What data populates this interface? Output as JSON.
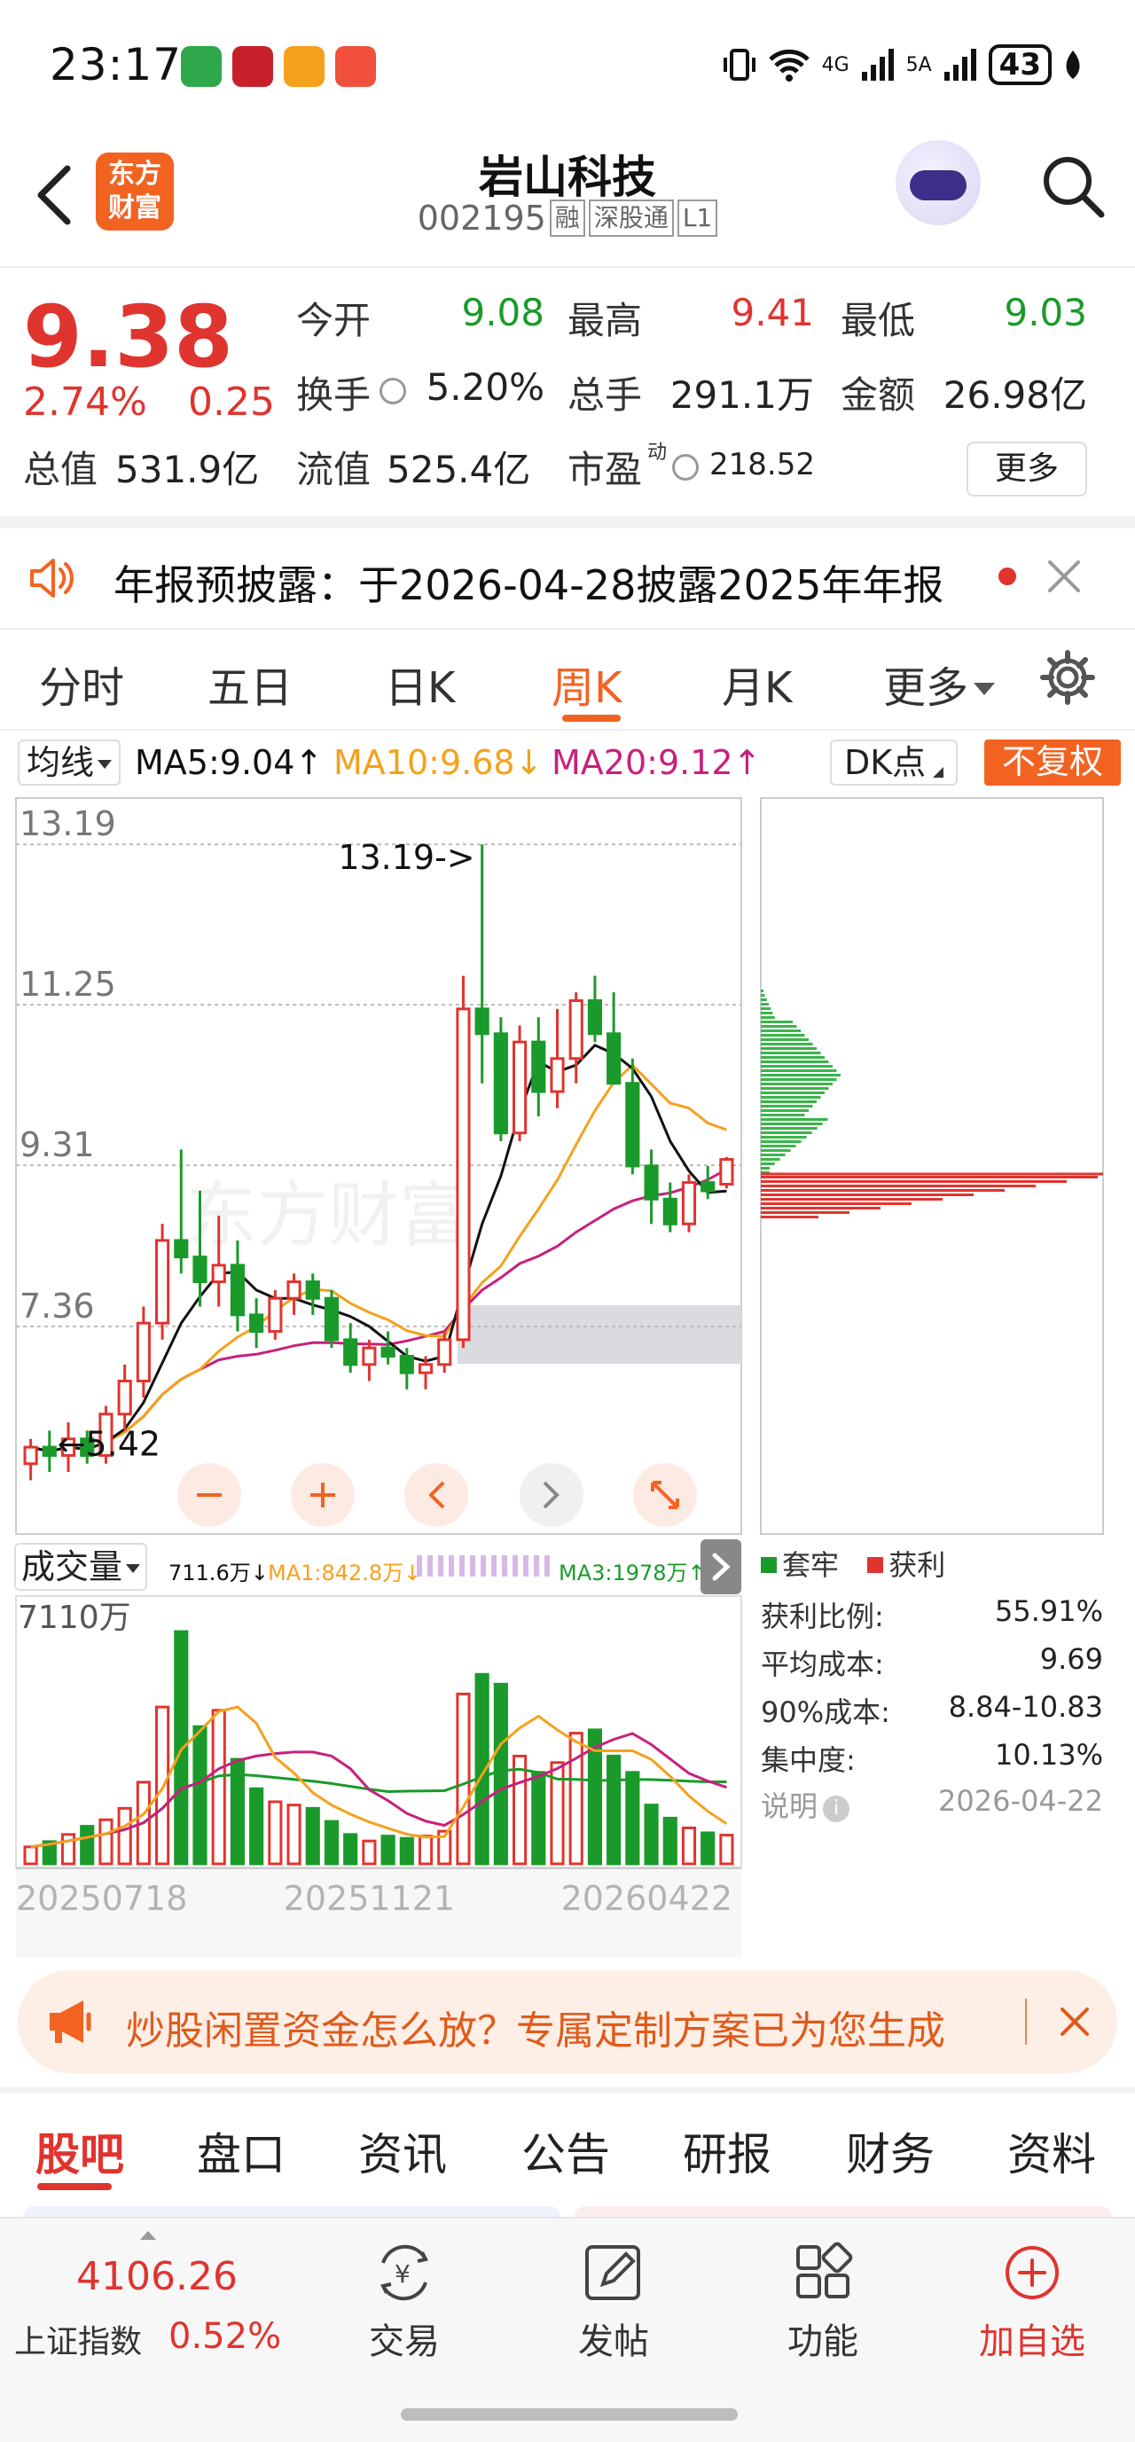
{
  "status": {
    "time": "23:17",
    "network": "4G",
    "network2": "5A",
    "battery": "43"
  },
  "header": {
    "title": "岩山科技",
    "code": "002195",
    "tags": [
      "融",
      "深股通",
      "L1"
    ],
    "logo_text": [
      "东方",
      "财富"
    ]
  },
  "quote": {
    "price": "9.38",
    "change_pct": "2.74%",
    "change": "0.25",
    "fields": [
      {
        "label": "今开",
        "value": "9.08",
        "color": "green"
      },
      {
        "label": "最高",
        "value": "9.41",
        "color": "red"
      },
      {
        "label": "最低",
        "value": "9.03",
        "color": "green"
      },
      {
        "label": "换手",
        "value": "5.20%",
        "color": "dark"
      },
      {
        "label": "总手",
        "value": "291.1万",
        "color": "dark"
      },
      {
        "label": "金额",
        "value": "26.98亿",
        "color": "dark"
      },
      {
        "label": "总值",
        "value": "531.9亿",
        "color": "dark"
      },
      {
        "label": "流值",
        "value": "525.4亿",
        "color": "dark"
      },
      {
        "label": "市盈",
        "value": "218.52",
        "color": "dark",
        "sup": "动"
      }
    ],
    "more_label": "更多"
  },
  "notice": {
    "text": "年报预披露：于2026-04-28披露2025年年报"
  },
  "period_tabs": [
    "分时",
    "五日",
    "日K",
    "周K",
    "月K",
    "更多"
  ],
  "period_active": "周K",
  "ma": {
    "select": "均线",
    "ma5": "MA5:9.04↑",
    "ma10": "MA10:9.68↓",
    "ma20": "MA20:9.12↑",
    "dk_label": "DK点",
    "fuquan_label": "不复权",
    "colors": {
      "ma5": "#111111",
      "ma10": "#f5a11c",
      "ma20": "#c8207e"
    }
  },
  "chart_data": {
    "type": "candlestick",
    "period": "weekly",
    "price_axis": [
      "13.19",
      "11.25",
      "9.31",
      "7.36"
    ],
    "ylim": [
      5.0,
      13.6
    ],
    "max_label": "13.19->",
    "min_label": "←5.42",
    "candles": [
      [
        5.7,
        6.0,
        5.5,
        5.9
      ],
      [
        5.9,
        6.1,
        5.6,
        5.8
      ],
      [
        5.8,
        6.2,
        5.6,
        6.0
      ],
      [
        6.0,
        6.1,
        5.7,
        5.8
      ],
      [
        5.8,
        6.4,
        5.7,
        6.3
      ],
      [
        6.3,
        6.9,
        6.1,
        6.7
      ],
      [
        6.7,
        7.6,
        6.5,
        7.4
      ],
      [
        7.4,
        8.6,
        7.2,
        8.4
      ],
      [
        8.4,
        9.5,
        8.0,
        8.2
      ],
      [
        8.2,
        9.0,
        7.6,
        7.9
      ],
      [
        7.9,
        8.7,
        7.6,
        8.1
      ],
      [
        8.1,
        8.4,
        7.3,
        7.5
      ],
      [
        7.5,
        7.7,
        7.1,
        7.3
      ],
      [
        7.3,
        7.8,
        7.2,
        7.7
      ],
      [
        7.7,
        8.0,
        7.5,
        7.9
      ],
      [
        7.9,
        8.0,
        7.5,
        7.7
      ],
      [
        7.7,
        7.8,
        7.1,
        7.2
      ],
      [
        7.2,
        7.4,
        6.8,
        6.9
      ],
      [
        6.9,
        7.2,
        6.7,
        7.1
      ],
      [
        7.1,
        7.3,
        6.9,
        7.0
      ],
      [
        7.0,
        7.1,
        6.6,
        6.8
      ],
      [
        6.8,
        7.0,
        6.6,
        6.9
      ],
      [
        6.9,
        7.3,
        6.8,
        7.2
      ],
      [
        7.2,
        11.6,
        7.1,
        11.2
      ],
      [
        11.2,
        13.19,
        10.3,
        10.9
      ],
      [
        10.9,
        11.1,
        9.6,
        9.7
      ],
      [
        9.7,
        11.0,
        9.6,
        10.8
      ],
      [
        10.8,
        11.1,
        9.9,
        10.2
      ],
      [
        10.2,
        11.2,
        10.0,
        10.6
      ],
      [
        10.6,
        11.4,
        10.3,
        11.3
      ],
      [
        11.3,
        11.6,
        10.8,
        10.9
      ],
      [
        10.9,
        11.4,
        10.4,
        10.3
      ],
      [
        10.3,
        10.6,
        9.2,
        9.3
      ],
      [
        9.3,
        9.5,
        8.6,
        8.9
      ],
      [
        8.9,
        9.1,
        8.5,
        8.6
      ],
      [
        8.6,
        9.2,
        8.5,
        9.1
      ],
      [
        9.1,
        9.3,
        8.9,
        9.0
      ],
      [
        9.08,
        9.41,
        9.03,
        9.38
      ]
    ],
    "volume_axis": [
      "7110万"
    ],
    "volumes": [
      520,
      680,
      900,
      1150,
      1350,
      1700,
      2500,
      4800,
      7110,
      4200,
      4700,
      3200,
      2300,
      1900,
      1800,
      1700,
      1300,
      900,
      700,
      850,
      780,
      850,
      1000,
      5200,
      5800,
      5500,
      3300,
      2800,
      3100,
      4000,
      4100,
      3300,
      2800,
      1800,
      1400,
      1100,
      950,
      880
    ],
    "date_labels": [
      "20250718",
      "20251121",
      "20260422"
    ]
  },
  "volume": {
    "select": "成交量",
    "v": "711.6万↓",
    "ma1": "MA1:842.8万↓",
    "ma3": "MA3:1978万↑"
  },
  "distribution": {
    "legend": [
      "套牢",
      "获利"
    ],
    "stats": [
      {
        "label": "获利比例:",
        "value": "55.91%"
      },
      {
        "label": "平均成本:",
        "value": "9.69"
      },
      {
        "label": "90%成本:",
        "value": "8.84-10.83"
      },
      {
        "label": "集中度:",
        "value": "10.13%"
      }
    ],
    "note_label": "说明",
    "note_date": "2026-04-22"
  },
  "promo": {
    "text": "炒股闲置资金怎么放？专属定制方案已为您生成"
  },
  "section_tabs": [
    "股吧",
    "盘口",
    "资讯",
    "公告",
    "研报",
    "财务",
    "资料"
  ],
  "bottom_nav": {
    "index_value": "4106.26",
    "index_name": "上证指数",
    "index_pct": "0.52%",
    "items": [
      "交易",
      "发帖",
      "功能",
      "加自选"
    ]
  },
  "colors": {
    "up": "#e0342f",
    "down": "#1a9a2a",
    "accent": "#f26322"
  }
}
